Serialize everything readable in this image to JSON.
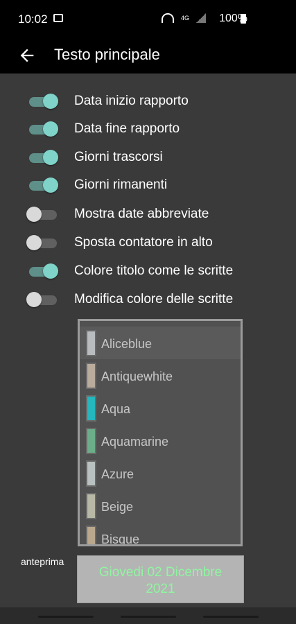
{
  "status_bar": {
    "time": "10:02",
    "network": "4G",
    "battery": "100%"
  },
  "app_bar": {
    "title": "Testo principale"
  },
  "toggles": [
    {
      "label": "Data inizio rapporto",
      "on": true
    },
    {
      "label": "Data fine rapporto",
      "on": true
    },
    {
      "label": "Giorni trascorsi",
      "on": true
    },
    {
      "label": "Giorni rimanenti",
      "on": true
    },
    {
      "label": "Mostra date abbreviate",
      "on": false
    },
    {
      "label": "Sposta contatore in alto",
      "on": false
    },
    {
      "label": "Colore titolo come le scritte",
      "on": true
    },
    {
      "label": "Modifica colore delle scritte",
      "on": false
    }
  ],
  "colors": [
    {
      "name": "Aliceblue",
      "swatch": "#b8bcbf"
    },
    {
      "name": "Antiquewhite",
      "swatch": "#b9ac9d"
    },
    {
      "name": "Aqua",
      "swatch": "#25b7bd"
    },
    {
      "name": "Aquamarine",
      "swatch": "#6cae89"
    },
    {
      "name": "Azure",
      "swatch": "#b9c0c0"
    },
    {
      "name": "Beige",
      "swatch": "#b8b8a6"
    },
    {
      "name": "Bisque",
      "swatch": "#b9a78e"
    }
  ],
  "preview": {
    "label": "anteprima",
    "line1": "Giovedi 02 Dicembre",
    "line2": "2021",
    "text_color": "#8ff5a0"
  },
  "accent": "#7fd3c9"
}
